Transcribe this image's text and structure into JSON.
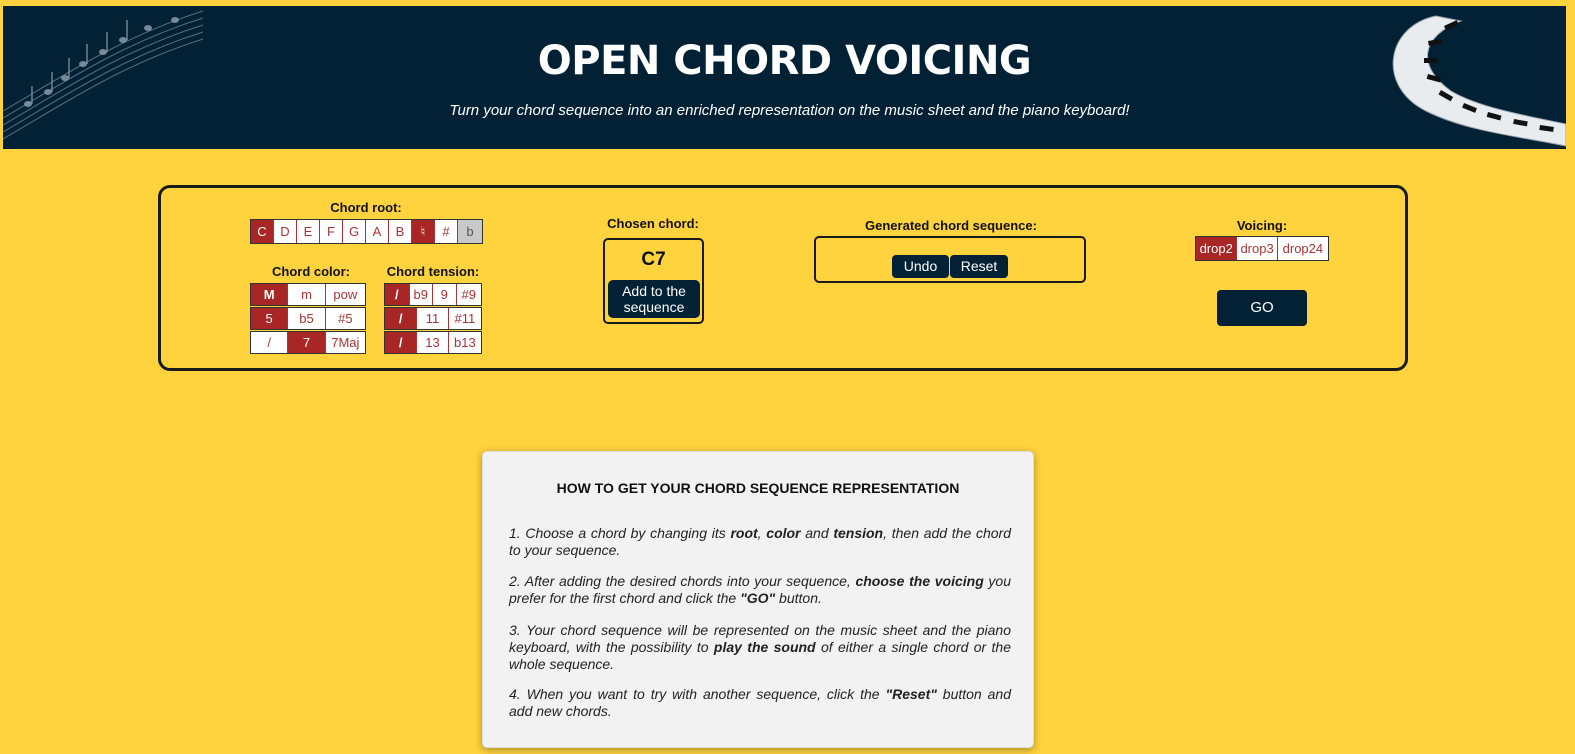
{
  "header": {
    "title": "OPEN CHORD VOICING",
    "subtitle": "Turn your chord sequence into an enriched representation on the music sheet and the piano keyboard!"
  },
  "chord_root": {
    "label": "Chord root:",
    "options": [
      "C",
      "D",
      "E",
      "F",
      "G",
      "A",
      "B"
    ],
    "selected": "C",
    "accidentals": [
      "♮",
      "#",
      "b"
    ],
    "selected_accidental": "♮"
  },
  "chord_color": {
    "label": "Chord color:",
    "rows": [
      [
        "M",
        "m",
        "pow"
      ],
      [
        "5",
        "b5",
        "#5"
      ],
      [
        "/",
        "7",
        "7Maj"
      ]
    ],
    "selected": [
      "M",
      "5",
      "7"
    ]
  },
  "chord_tension": {
    "label": "Chord tension:",
    "rows": [
      [
        "/",
        "b9",
        "9",
        "#9"
      ],
      [
        "/",
        "11",
        "#11"
      ],
      [
        "/",
        "13",
        "b13"
      ]
    ],
    "selected": [
      "/",
      "/",
      "/"
    ]
  },
  "chosen": {
    "label": "Chosen chord:",
    "chord": "C7",
    "add_button": "Add to the sequence"
  },
  "sequence": {
    "label": "Generated chord sequence:",
    "undo": "Undo",
    "reset": "Reset"
  },
  "voicing": {
    "label": "Voicing:",
    "options": [
      "drop2",
      "drop3",
      "drop24"
    ],
    "selected": "drop2",
    "go": "GO"
  },
  "howto": {
    "title": "HOW TO GET YOUR CHORD SEQUENCE REPRESENTATION",
    "step1": {
      "a": "1. Choose a chord by changing its ",
      "b": "root",
      "c": ", ",
      "d": "color",
      "e": " and ",
      "f": "tension",
      "g": ", then add the chord to your sequence."
    },
    "step2": {
      "a": "2. After adding the desired chords into your sequence, ",
      "b": "choose the voicing",
      "c": " you prefer for the first chord and click the ",
      "d": "\"GO\"",
      "e": " button."
    },
    "step3": {
      "a": "3. Your chord sequence will be represented on the music sheet and the piano keyboard, with the possibility to ",
      "b": "play the sound",
      "c": " of either a single chord or the whole sequence."
    },
    "step4": {
      "a": "4. When you want to try with another sequence, click the ",
      "b": "\"Reset\"",
      "c": " button and add new chords."
    }
  },
  "colors": {
    "header_bg": "#022135",
    "page_bg": "#ffd33d",
    "active": "#a82626",
    "button_bg": "#022135"
  }
}
